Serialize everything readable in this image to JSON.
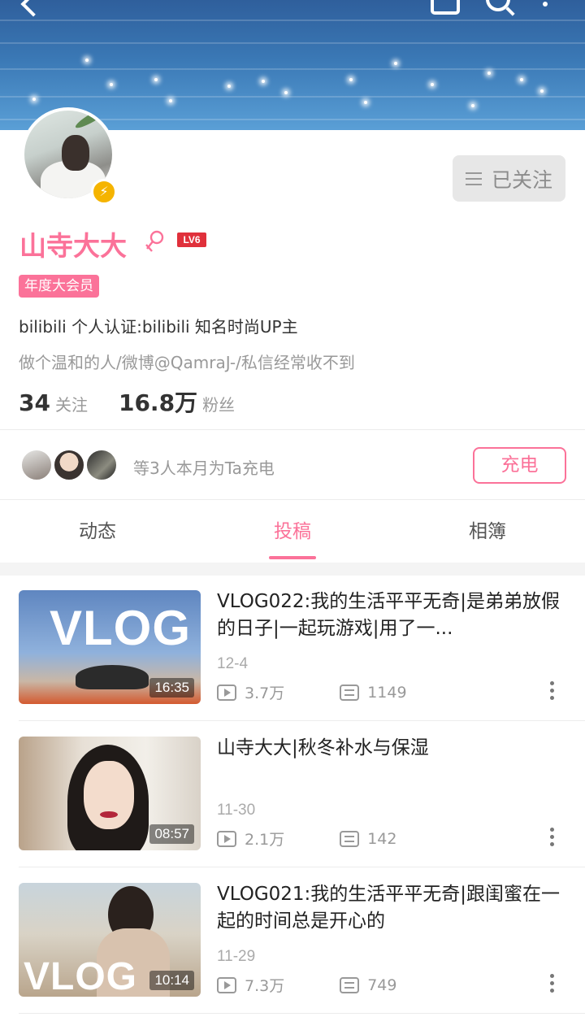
{
  "profile": {
    "name": "山寺大大",
    "level": "LV6",
    "vip_tag": "年度大会员",
    "certification": "bilibili 个人认证:bilibili 知名时尚UP主",
    "signature": "做个温和的人/微博@QamraJ-/私信经常收不到",
    "following_count": "34",
    "following_label": "关注",
    "followers_count": "16.8万",
    "followers_label": "粉丝",
    "follow_button": "已关注"
  },
  "charge": {
    "text": "等3人本月为Ta充电",
    "button": "充电"
  },
  "tabs": [
    {
      "label": "动态",
      "active": false
    },
    {
      "label": "投稿",
      "active": true
    },
    {
      "label": "相簿",
      "active": false
    }
  ],
  "videos": [
    {
      "title": "VLOG022:我的生活平平无奇|是弟弟放假的日子|一起玩游戏|用了一...",
      "date": "12-4",
      "views": "3.7万",
      "danmaku": "1149",
      "duration": "16:35",
      "thumb_text": "VLOG"
    },
    {
      "title": "山寺大大|秋冬补水与保湿",
      "date": "11-30",
      "views": "2.1万",
      "danmaku": "142",
      "duration": "08:57"
    },
    {
      "title": "VLOG021:我的生活平平无奇|跟闺蜜在一起的时间总是开心的",
      "date": "11-29",
      "views": "7.3万",
      "danmaku": "749",
      "duration": "10:14",
      "thumb_text": "VLOG"
    }
  ],
  "colors": {
    "accent": "#fb7299",
    "level_badge": "#e0303b",
    "verified_badge": "#f5b400"
  }
}
